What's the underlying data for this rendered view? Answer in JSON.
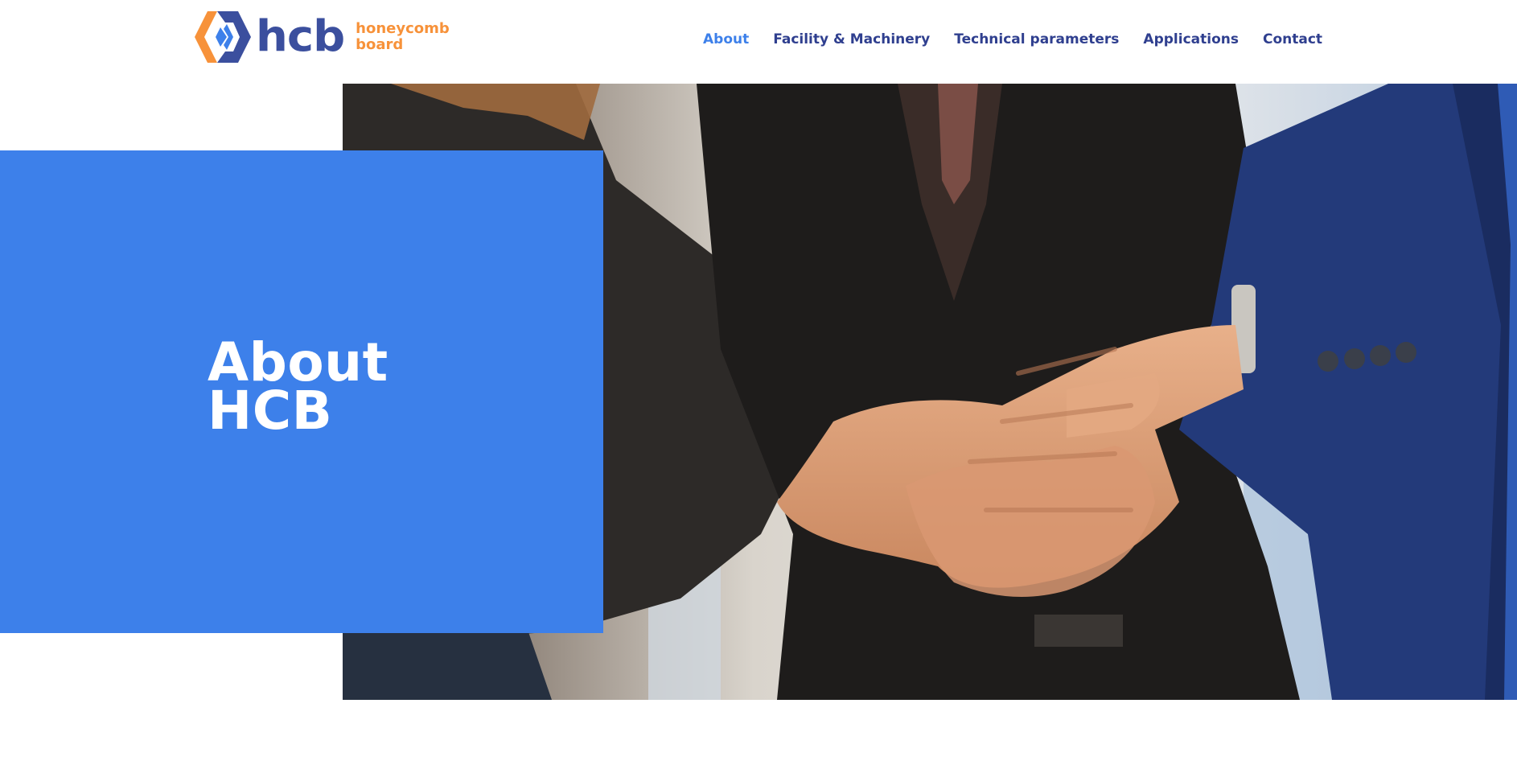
{
  "brand": {
    "wordmark": "hcb",
    "tagline_line1": "honeycomb",
    "tagline_line2": "board",
    "colors": {
      "primary_blue": "#3b4f9e",
      "orange": "#f7923a",
      "accent_blue": "#3d80ea"
    }
  },
  "nav": {
    "items": [
      {
        "label": "About",
        "active": true
      },
      {
        "label": "Facility & Machinery",
        "active": false
      },
      {
        "label": "Technical parameters",
        "active": false
      },
      {
        "label": "Applications",
        "active": false
      },
      {
        "label": "Contact",
        "active": false
      }
    ]
  },
  "hero": {
    "title_line1": "About",
    "title_line2": "HCB",
    "image_subject": "team-hands-stacked-photo"
  }
}
